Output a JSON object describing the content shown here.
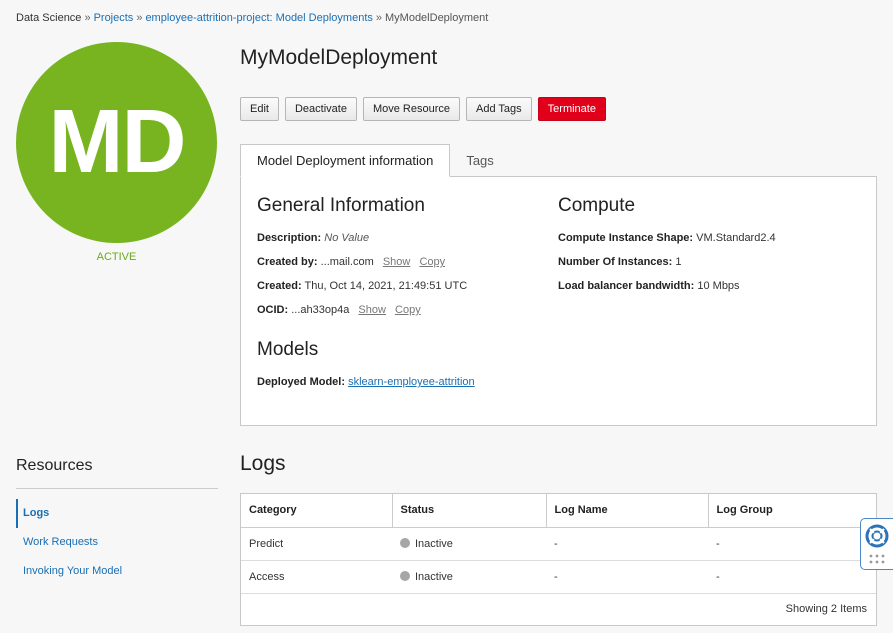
{
  "breadcrumb": {
    "root": "Data Science",
    "separator": "»",
    "projects": "Projects",
    "project": "employee-attrition-project: Model Deployments",
    "current": "MyModelDeployment"
  },
  "avatar": {
    "initials": "MD",
    "status": "ACTIVE",
    "color": "#77b41f"
  },
  "title": "MyModelDeployment",
  "actions": {
    "edit": "Edit",
    "deactivate": "Deactivate",
    "move": "Move Resource",
    "add_tags": "Add Tags",
    "terminate": "Terminate"
  },
  "tabs": {
    "info": "Model Deployment information",
    "tags": "Tags"
  },
  "general": {
    "title": "General Information",
    "description_label": "Description:",
    "description_value": "No Value",
    "created_by_label": "Created by:",
    "created_by_value": "...mail.com",
    "created_label": "Created:",
    "created_value": "Thu, Oct 14, 2021, 21:49:51 UTC",
    "ocid_label": "OCID:",
    "ocid_value": "...ah33op4a",
    "show": "Show",
    "copy": "Copy"
  },
  "compute": {
    "title": "Compute",
    "shape_label": "Compute Instance Shape:",
    "shape_value": "VM.Standard2.4",
    "instances_label": "Number Of Instances:",
    "instances_value": "1",
    "bandwidth_label": "Load balancer bandwidth:",
    "bandwidth_value": "10 Mbps"
  },
  "models": {
    "title": "Models",
    "deployed_label": "Deployed Model:",
    "deployed_value": "sklearn-employee-attrition"
  },
  "resources": {
    "title": "Resources",
    "items": [
      "Logs",
      "Work Requests",
      "Invoking Your Model"
    ]
  },
  "logs": {
    "title": "Logs",
    "columns": [
      "Category",
      "Status",
      "Log Name",
      "Log Group"
    ],
    "rows": [
      {
        "category": "Predict",
        "status": "Inactive",
        "log_name": "-",
        "log_group": "-"
      },
      {
        "category": "Access",
        "status": "Inactive",
        "log_name": "-",
        "log_group": "-"
      }
    ],
    "footer": "Showing 2 Items"
  },
  "colors": {
    "accent": "#1a6fb3",
    "danger": "#e0001a",
    "active": "#6aaa1e"
  },
  "icons": {
    "help": "lifebuoy-icon",
    "grip": "grip-dots-icon"
  }
}
